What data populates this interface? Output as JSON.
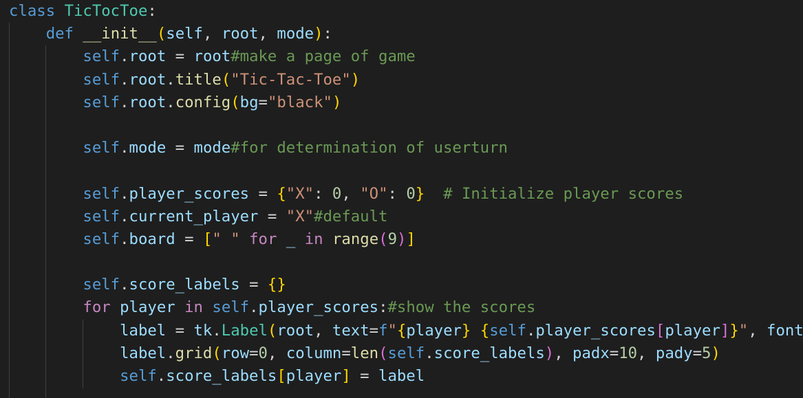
{
  "editor": {
    "lines": [
      [
        {
          "t": "kw",
          "v": "class"
        },
        {
          "t": "",
          "v": " "
        },
        {
          "t": "cls",
          "v": "TicTocToe"
        },
        {
          "t": "",
          "v": ":"
        }
      ],
      [
        {
          "t": "",
          "v": "    "
        },
        {
          "t": "kw",
          "v": "def"
        },
        {
          "t": "",
          "v": " "
        },
        {
          "t": "fn",
          "v": "__init__"
        },
        {
          "t": "b1",
          "v": "("
        },
        {
          "t": "var",
          "v": "self"
        },
        {
          "t": "",
          "v": ", "
        },
        {
          "t": "var",
          "v": "root"
        },
        {
          "t": "",
          "v": ", "
        },
        {
          "t": "var",
          "v": "mode"
        },
        {
          "t": "b1",
          "v": ")"
        },
        {
          "t": "",
          "v": ":"
        }
      ],
      [
        {
          "t": "",
          "v": "        "
        },
        {
          "t": "kw",
          "v": "self"
        },
        {
          "t": "",
          "v": "."
        },
        {
          "t": "var",
          "v": "root"
        },
        {
          "t": "",
          "v": " = "
        },
        {
          "t": "var",
          "v": "root"
        },
        {
          "t": "cm",
          "v": "#make a page of game"
        }
      ],
      [
        {
          "t": "",
          "v": "        "
        },
        {
          "t": "kw",
          "v": "self"
        },
        {
          "t": "",
          "v": "."
        },
        {
          "t": "var",
          "v": "root"
        },
        {
          "t": "",
          "v": "."
        },
        {
          "t": "fn",
          "v": "title"
        },
        {
          "t": "b1",
          "v": "("
        },
        {
          "t": "str",
          "v": "\"Tic-Tac-Toe\""
        },
        {
          "t": "b1",
          "v": ")"
        }
      ],
      [
        {
          "t": "",
          "v": "        "
        },
        {
          "t": "kw",
          "v": "self"
        },
        {
          "t": "",
          "v": "."
        },
        {
          "t": "var",
          "v": "root"
        },
        {
          "t": "",
          "v": "."
        },
        {
          "t": "fn",
          "v": "config"
        },
        {
          "t": "b1",
          "v": "("
        },
        {
          "t": "var",
          "v": "bg"
        },
        {
          "t": "",
          "v": "="
        },
        {
          "t": "str",
          "v": "\"black\""
        },
        {
          "t": "b1",
          "v": ")"
        }
      ],
      [],
      [
        {
          "t": "",
          "v": "        "
        },
        {
          "t": "kw",
          "v": "self"
        },
        {
          "t": "",
          "v": "."
        },
        {
          "t": "var",
          "v": "mode"
        },
        {
          "t": "",
          "v": " = "
        },
        {
          "t": "var",
          "v": "mode"
        },
        {
          "t": "cm",
          "v": "#for determination of userturn"
        }
      ],
      [],
      [
        {
          "t": "",
          "v": "        "
        },
        {
          "t": "kw",
          "v": "self"
        },
        {
          "t": "",
          "v": "."
        },
        {
          "t": "var",
          "v": "player_scores"
        },
        {
          "t": "",
          "v": " = "
        },
        {
          "t": "b1",
          "v": "{"
        },
        {
          "t": "str",
          "v": "\"X\""
        },
        {
          "t": "",
          "v": ": "
        },
        {
          "t": "num",
          "v": "0"
        },
        {
          "t": "",
          "v": ", "
        },
        {
          "t": "str",
          "v": "\"O\""
        },
        {
          "t": "",
          "v": ": "
        },
        {
          "t": "num",
          "v": "0"
        },
        {
          "t": "b1",
          "v": "}"
        },
        {
          "t": "",
          "v": "  "
        },
        {
          "t": "cm",
          "v": "# Initialize player scores"
        }
      ],
      [
        {
          "t": "",
          "v": "        "
        },
        {
          "t": "kw",
          "v": "self"
        },
        {
          "t": "",
          "v": "."
        },
        {
          "t": "var",
          "v": "current_player"
        },
        {
          "t": "",
          "v": " = "
        },
        {
          "t": "str",
          "v": "\"X\""
        },
        {
          "t": "cm",
          "v": "#default"
        }
      ],
      [
        {
          "t": "",
          "v": "        "
        },
        {
          "t": "kw",
          "v": "self"
        },
        {
          "t": "",
          "v": "."
        },
        {
          "t": "var",
          "v": "board"
        },
        {
          "t": "",
          "v": " = "
        },
        {
          "t": "b1",
          "v": "["
        },
        {
          "t": "str",
          "v": "\" \""
        },
        {
          "t": "",
          "v": " "
        },
        {
          "t": "ctrl",
          "v": "for"
        },
        {
          "t": "",
          "v": " "
        },
        {
          "t": "var",
          "v": "_"
        },
        {
          "t": "",
          "v": " "
        },
        {
          "t": "ctrl",
          "v": "in"
        },
        {
          "t": "",
          "v": " "
        },
        {
          "t": "fn",
          "v": "range"
        },
        {
          "t": "b2",
          "v": "("
        },
        {
          "t": "num",
          "v": "9"
        },
        {
          "t": "b2",
          "v": ")"
        },
        {
          "t": "b1",
          "v": "]"
        }
      ],
      [],
      [
        {
          "t": "",
          "v": "        "
        },
        {
          "t": "kw",
          "v": "self"
        },
        {
          "t": "",
          "v": "."
        },
        {
          "t": "var",
          "v": "score_labels"
        },
        {
          "t": "",
          "v": " = "
        },
        {
          "t": "b1",
          "v": "{}"
        }
      ],
      [
        {
          "t": "",
          "v": "        "
        },
        {
          "t": "ctrl",
          "v": "for"
        },
        {
          "t": "",
          "v": " "
        },
        {
          "t": "var",
          "v": "player"
        },
        {
          "t": "",
          "v": " "
        },
        {
          "t": "ctrl",
          "v": "in"
        },
        {
          "t": "",
          "v": " "
        },
        {
          "t": "kw",
          "v": "self"
        },
        {
          "t": "",
          "v": "."
        },
        {
          "t": "var",
          "v": "player_scores"
        },
        {
          "t": "",
          "v": ":"
        },
        {
          "t": "cm",
          "v": "#show the scores"
        }
      ],
      [
        {
          "t": "",
          "v": "            "
        },
        {
          "t": "var",
          "v": "label"
        },
        {
          "t": "",
          "v": " = "
        },
        {
          "t": "var",
          "v": "tk"
        },
        {
          "t": "",
          "v": "."
        },
        {
          "t": "cls",
          "v": "Label"
        },
        {
          "t": "b1",
          "v": "("
        },
        {
          "t": "var",
          "v": "root"
        },
        {
          "t": "",
          "v": ", "
        },
        {
          "t": "var",
          "v": "text"
        },
        {
          "t": "",
          "v": "="
        },
        {
          "t": "kw",
          "v": "f"
        },
        {
          "t": "str",
          "v": "\""
        },
        {
          "t": "b1",
          "v": "{"
        },
        {
          "t": "var",
          "v": "player"
        },
        {
          "t": "b1",
          "v": "}"
        },
        {
          "t": "str",
          "v": " "
        },
        {
          "t": "b1",
          "v": "{"
        },
        {
          "t": "kw",
          "v": "self"
        },
        {
          "t": "",
          "v": "."
        },
        {
          "t": "var",
          "v": "player_scores"
        },
        {
          "t": "b2",
          "v": "["
        },
        {
          "t": "var",
          "v": "player"
        },
        {
          "t": "b2",
          "v": "]"
        },
        {
          "t": "b1",
          "v": "}"
        },
        {
          "t": "str",
          "v": "\""
        },
        {
          "t": "",
          "v": ", "
        },
        {
          "t": "var",
          "v": "font"
        }
      ],
      [
        {
          "t": "",
          "v": "            "
        },
        {
          "t": "var",
          "v": "label"
        },
        {
          "t": "",
          "v": "."
        },
        {
          "t": "fn",
          "v": "grid"
        },
        {
          "t": "b1",
          "v": "("
        },
        {
          "t": "var",
          "v": "row"
        },
        {
          "t": "",
          "v": "="
        },
        {
          "t": "num",
          "v": "0"
        },
        {
          "t": "",
          "v": ", "
        },
        {
          "t": "var",
          "v": "column"
        },
        {
          "t": "",
          "v": "="
        },
        {
          "t": "fn",
          "v": "len"
        },
        {
          "t": "b2",
          "v": "("
        },
        {
          "t": "kw",
          "v": "self"
        },
        {
          "t": "",
          "v": "."
        },
        {
          "t": "var",
          "v": "score_labels"
        },
        {
          "t": "b2",
          "v": ")"
        },
        {
          "t": "",
          "v": ", "
        },
        {
          "t": "var",
          "v": "padx"
        },
        {
          "t": "",
          "v": "="
        },
        {
          "t": "num",
          "v": "10"
        },
        {
          "t": "",
          "v": ", "
        },
        {
          "t": "var",
          "v": "pady"
        },
        {
          "t": "",
          "v": "="
        },
        {
          "t": "num",
          "v": "5"
        },
        {
          "t": "b1",
          "v": ")"
        }
      ],
      [
        {
          "t": "",
          "v": "            "
        },
        {
          "t": "kw",
          "v": "self"
        },
        {
          "t": "",
          "v": "."
        },
        {
          "t": "var",
          "v": "score_labels"
        },
        {
          "t": "b1",
          "v": "["
        },
        {
          "t": "var",
          "v": "player"
        },
        {
          "t": "b1",
          "v": "]"
        },
        {
          "t": "",
          "v": " = "
        },
        {
          "t": "var",
          "v": "label"
        }
      ]
    ]
  }
}
